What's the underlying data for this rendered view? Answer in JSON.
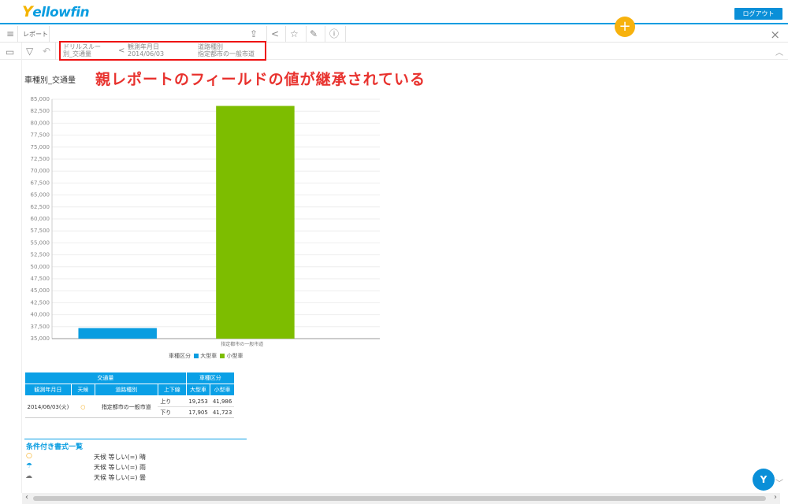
{
  "header": {
    "logo": "Yellowfin",
    "logout_label": "ログアウト",
    "add_label": "+"
  },
  "toolbar": {
    "report_label": "レポート",
    "close_label": "×"
  },
  "breadcrumb": {
    "items": [
      {
        "line1": "ドリルスルー",
        "line2": "別_交通量"
      },
      {
        "line1": "観測年月日",
        "line2": "2014/06/03"
      },
      {
        "line1": "道路種別",
        "line2": "指定都市の一般市道"
      }
    ],
    "back_label": "<"
  },
  "annotation": "親レポートのフィールドの値が継承されている",
  "report_title": "車種別_交通量",
  "chart_data": {
    "type": "bar",
    "categories": [
      "指定都市の一般市道"
    ],
    "series": [
      {
        "name": "大型車",
        "values": [
          37200
        ],
        "color": "#0a9de0"
      },
      {
        "name": "小型車",
        "values": [
          83600
        ],
        "color": "#7dbd00"
      }
    ],
    "ylim": [
      35000,
      85000
    ],
    "yticks": [
      "35,000",
      "37,500",
      "40,000",
      "42,500",
      "45,000",
      "47,500",
      "50,000",
      "52,500",
      "55,000",
      "57,500",
      "60,000",
      "62,500",
      "65,000",
      "67,500",
      "70,000",
      "72,500",
      "75,000",
      "77,500",
      "80,000",
      "82,500",
      "85,000"
    ],
    "legend_title": "車種区分",
    "grid": true
  },
  "table": {
    "group_headers": [
      "交通量",
      "車種区分"
    ],
    "columns": [
      "観測年月日",
      "天候",
      "道路種別",
      "上下線",
      "大型車",
      "小型車"
    ],
    "date": "2014/06/03(火)",
    "weather_icon": "sun-icon",
    "road": "指定都市の一般市道",
    "rows": [
      {
        "dir": "上り",
        "large": "19,253",
        "small": "41,986"
      },
      {
        "dir": "下り",
        "large": "17,905",
        "small": "41,723"
      }
    ]
  },
  "conditions": {
    "title": "条件付き書式一覧",
    "items": [
      {
        "icon": "sun-icon",
        "text": "天候 等しい(=) 晴"
      },
      {
        "icon": "umbrella-icon",
        "text": "天候 等しい(=) 雨"
      },
      {
        "icon": "cloud-icon",
        "text": "天候 等しい(=) 曇"
      }
    ]
  },
  "help_label": "Y",
  "colors": {
    "accent": "#0a9de0",
    "highlight": "#ee1111",
    "annotation": "#e8322e",
    "plus": "#f7b20d"
  }
}
